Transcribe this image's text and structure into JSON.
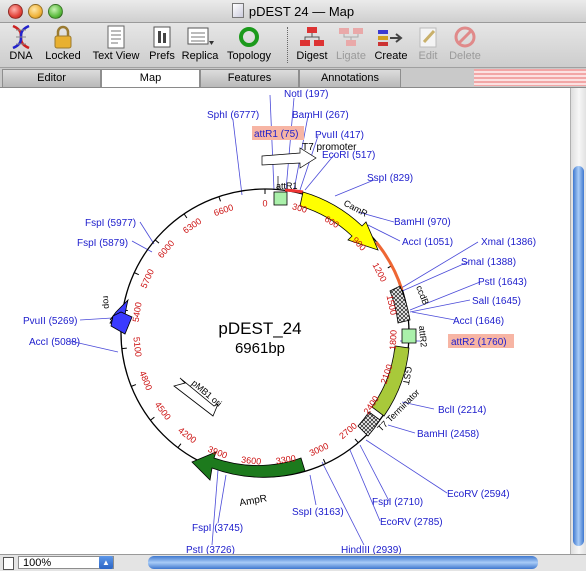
{
  "window": {
    "title": "pDEST 24 — Map"
  },
  "toolbar": {
    "dna": "DNA",
    "locked": "Locked",
    "text_view": "Text View",
    "prefs": "Prefs",
    "replica": "Replica",
    "topology": "Topology",
    "digest": "Digest",
    "ligate": "Ligate",
    "create": "Create",
    "edit": "Edit",
    "delete": "Delete"
  },
  "tabs": {
    "editor": "Editor",
    "map": "Map",
    "features": "Features",
    "annotations": "Annotations"
  },
  "map": {
    "name": "pDEST_24",
    "length": "6961bp",
    "ticks": [
      "0",
      "300",
      "600",
      "900",
      "1200",
      "1500",
      "1800",
      "2100",
      "2400",
      "2700",
      "3000",
      "3300",
      "3600",
      "3900",
      "4200",
      "4500",
      "4800",
      "5100",
      "5400",
      "5700",
      "6000",
      "6300",
      "6600"
    ],
    "features": {
      "attR1": "attR1",
      "t7_promoter": "T7 promoter",
      "camr": "CamR",
      "ccdb": "ccdB",
      "attR2": "attR2",
      "gst": "GST",
      "t7_terminator": "T7 Terminator",
      "ampr": "AmpR",
      "pmb1_ori": "pMB1 ori",
      "rop": "rop"
    },
    "sites": {
      "noti": "NotI (197)",
      "bamhi_267": "BamHI (267)",
      "pvuii_417": "PvuII (417)",
      "ecori": "EcoRI (517)",
      "sspi_829": "SspI (829)",
      "sphi": "SphI (6777)",
      "attr1": "attR1 (75)",
      "bamhi_970": "BamHI (970)",
      "acci_1051": "AccI (1051)",
      "xmai": "XmaI (1386)",
      "smai": "SmaI (1388)",
      "psti_1643": "PstI (1643)",
      "sali": "SalI (1645)",
      "acci_1646": "AccI (1646)",
      "attr2": "attR2 (1760)",
      "bcli": "BclI (2214)",
      "bamhi_2458": "BamHI (2458)",
      "ecorv_2594": "EcoRV (2594)",
      "fspi_2710": "FspI (2710)",
      "ecorv_2785": "EcoRV (2785)",
      "hindiii": "HindIII (2939)",
      "sspi_3163": "SspI (3163)",
      "fspi_3745": "FspI (3745)",
      "psti_3726": "PstI (3726)",
      "fspi_5977": "FspI (5977)",
      "fspi_5879": "FspI (5879)",
      "pvuii_5269": "PvuII (5269)",
      "acci_5088": "AccI (5088)"
    }
  },
  "status": {
    "zoom": "100%"
  },
  "colors": {
    "site_label": "#1d1dcc",
    "tick_label": "#cc1111",
    "camr": "#ffff00",
    "gst": "#a8c93a",
    "ampr": "#1d7a1d",
    "rop": "#3b3bff",
    "att": "#aaf0aa",
    "highlight": "#f7b5a4"
  }
}
